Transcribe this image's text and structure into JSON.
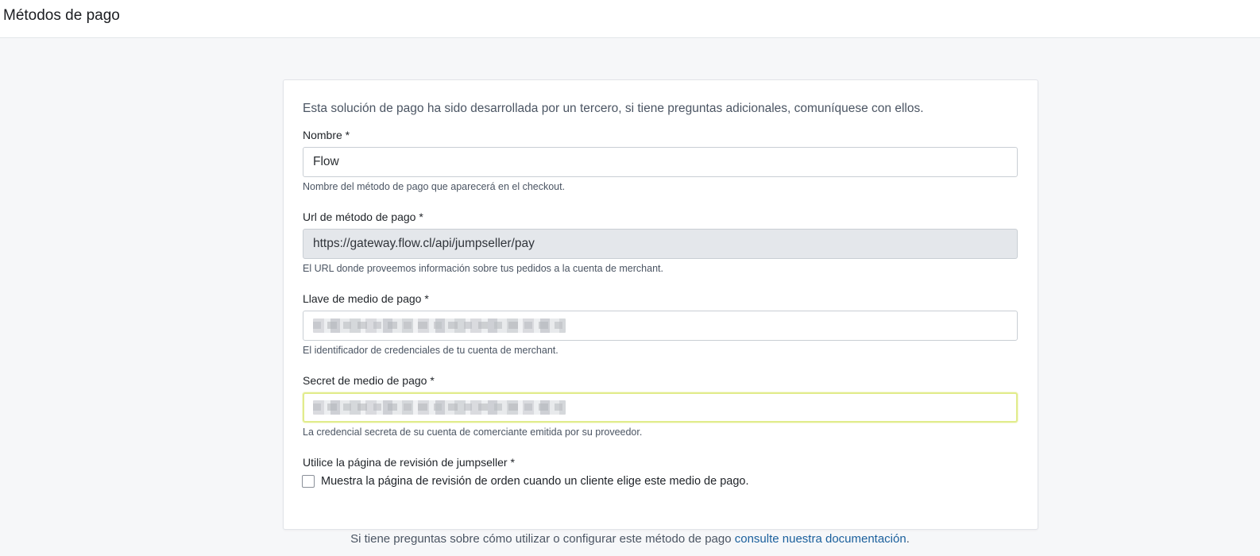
{
  "header": {
    "title": "Métodos de pago"
  },
  "form": {
    "intro": "Esta solución de pago ha sido desarrollada por un tercero, si tiene preguntas adicionales, comuníquese con ellos.",
    "name": {
      "label": "Nombre *",
      "value": "Flow",
      "hint": "Nombre del método de pago que aparecerá en el checkout."
    },
    "url": {
      "label": "Url de método de pago *",
      "value": "https://gateway.flow.cl/api/jumpseller/pay",
      "hint": "El URL donde proveemos información sobre tus pedidos a la cuenta de merchant."
    },
    "key": {
      "label": "Llave de medio de pago *",
      "hint": "El identificador de credenciales de tu cuenta de merchant."
    },
    "secret": {
      "label": "Secret de medio de pago *",
      "hint": "La credencial secreta de su cuenta de comerciante emitida por su proveedor."
    },
    "review": {
      "label": "Utilice la página de revisión de jumpseller *",
      "checkbox_label": "Muestra la página de revisión de orden cuando un cliente elige este medio de pago.",
      "checked": false
    }
  },
  "footer": {
    "text": "Si tiene preguntas sobre cómo utilizar o configurar este método de pago ",
    "link": "consulte nuestra documentación",
    "suffix": "."
  },
  "colors": {
    "link": "#1a5f9c",
    "focus_border": "#e1ec8c"
  }
}
